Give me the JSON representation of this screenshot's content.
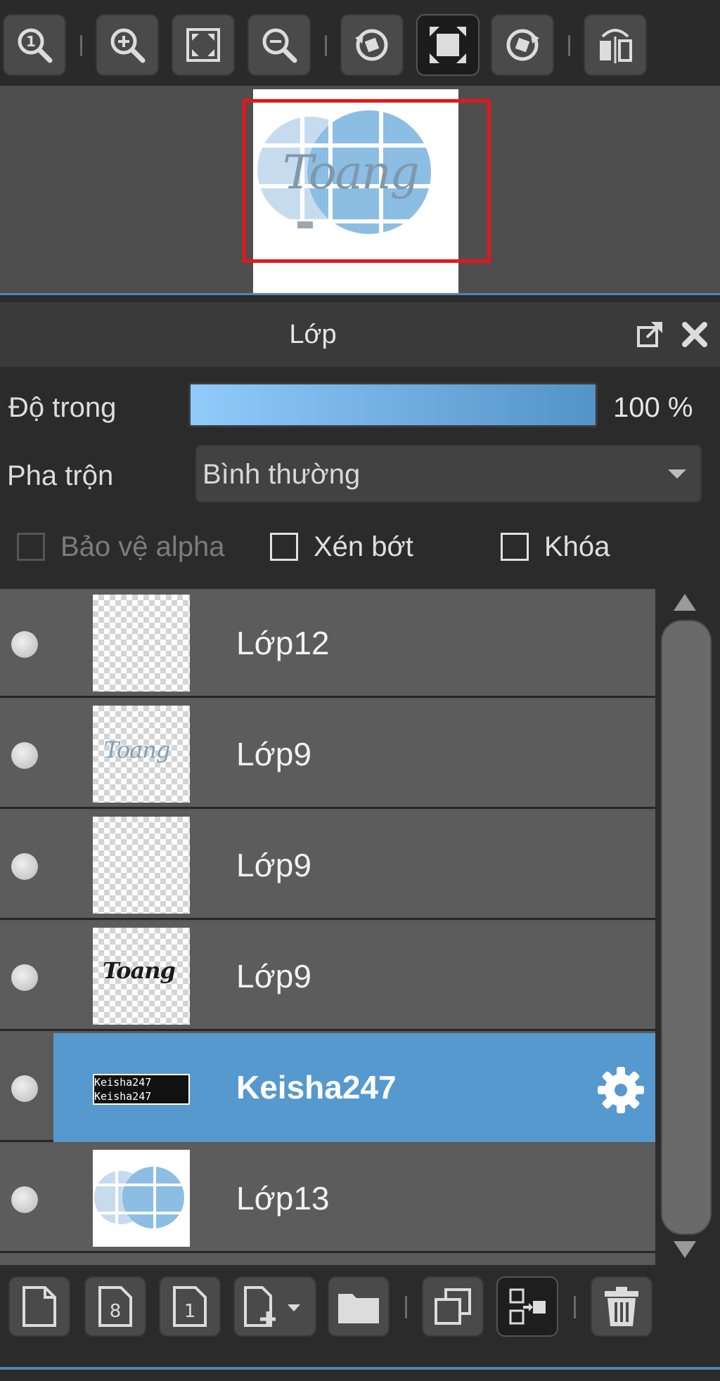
{
  "toolbar": {
    "buttons": [
      {
        "name": "zoom-actual-size-icon"
      },
      {
        "name": "zoom-in-icon"
      },
      {
        "name": "fit-to-window-icon"
      },
      {
        "name": "zoom-out-icon"
      },
      {
        "name": "rotate-left-icon"
      },
      {
        "name": "fit-screen-icon"
      },
      {
        "name": "rotate-right-icon"
      },
      {
        "name": "flip-horizontal-icon"
      }
    ]
  },
  "navigator": {
    "preview_text": "Toang"
  },
  "layers_panel": {
    "title": "Lớp",
    "opacity_label": "Độ trong",
    "opacity_value": "100 %",
    "opacity_percent": 100,
    "blend_label": "Pha trộn",
    "blend_value": "Bình thường",
    "protect_alpha_label": "Bảo vệ alpha",
    "clipping_label": "Xén bớt",
    "lock_label": "Khóa",
    "layers": [
      {
        "name": "Lớp12",
        "thumb": "empty",
        "selected": false
      },
      {
        "name": "Lớp9",
        "thumb": "blue-text",
        "selected": false
      },
      {
        "name": "Lớp9",
        "thumb": "empty",
        "selected": false
      },
      {
        "name": "Lớp9",
        "thumb": "black-text",
        "selected": false
      },
      {
        "name": "Keisha247",
        "thumb": "watermark",
        "selected": true
      },
      {
        "name": "Lớp13",
        "thumb": "circles",
        "selected": false
      }
    ],
    "layer_thumb_text": "Toang",
    "watermark_text_1": "Keisha247",
    "watermark_text_2": "Keisha247"
  },
  "colors": {
    "accent": "#5599cf",
    "frame": "#e5171b",
    "opacity_start": "#8fcbfb",
    "opacity_end": "#5493c6"
  }
}
